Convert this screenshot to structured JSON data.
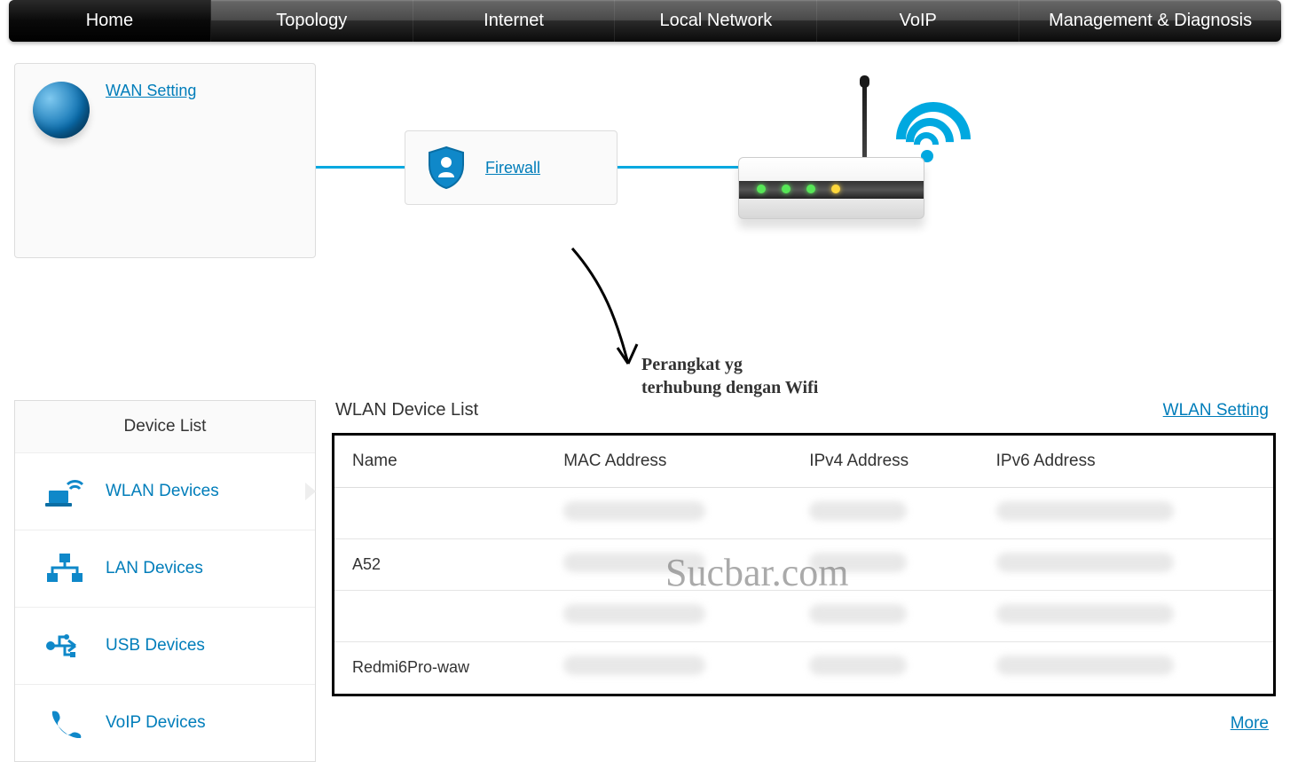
{
  "nav": {
    "items": [
      {
        "label": "Home",
        "active": true
      },
      {
        "label": "Topology",
        "active": false
      },
      {
        "label": "Internet",
        "active": false
      },
      {
        "label": "Local Network",
        "active": false
      },
      {
        "label": "VoIP",
        "active": false
      },
      {
        "label": "Management & Diagnosis",
        "active": false
      }
    ]
  },
  "topology": {
    "wan_link": "WAN Setting",
    "firewall_link": "Firewall"
  },
  "annotation": {
    "line1": "Perangkat yg",
    "line2": "terhubung dengan Wifi"
  },
  "sidebar": {
    "title": "Device List",
    "items": [
      {
        "label": "WLAN Devices",
        "icon": "wifi-laptop-icon"
      },
      {
        "label": "LAN Devices",
        "icon": "lan-icon"
      },
      {
        "label": "USB Devices",
        "icon": "usb-icon"
      },
      {
        "label": "VoIP Devices",
        "icon": "phone-icon"
      }
    ]
  },
  "main": {
    "title": "WLAN Device List",
    "setting_link": "WLAN Setting",
    "columns": [
      "Name",
      "MAC Address",
      "IPv4 Address",
      "IPv6 Address"
    ],
    "rows": [
      {
        "name": "",
        "mac": "",
        "ipv4": "",
        "ipv6": ""
      },
      {
        "name": "A52",
        "mac": "",
        "ipv4": "",
        "ipv6": ""
      },
      {
        "name": "",
        "mac": "",
        "ipv4": "",
        "ipv6": ""
      },
      {
        "name": "Redmi6Pro-waw",
        "mac": "",
        "ipv4": "",
        "ipv6": ""
      }
    ],
    "more_link": "More"
  },
  "watermark": "Sucbar.com",
  "colors": {
    "accent": "#00a8e0",
    "link": "#007dba"
  }
}
